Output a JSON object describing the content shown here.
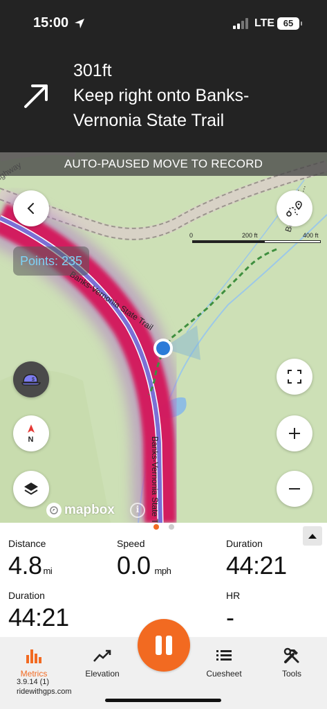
{
  "status_bar": {
    "time": "15:00",
    "network": "LTE",
    "battery": "65",
    "icons": [
      "location-arrow-icon",
      "signal-bars-icon"
    ]
  },
  "navigation": {
    "distance": "301ft",
    "instruction": "Keep right onto Banks-Vernonia State Trail",
    "turn_icon": "arrow-up-right-icon"
  },
  "map": {
    "banner": "AUTO-PAUSED MOVE TO RECORD",
    "points_label": "Points: 235",
    "scale": {
      "labels": [
        "0",
        "200 ft",
        "400 ft"
      ]
    },
    "road_labels": [
      "Banks-Vernonia State Trail",
      "Banks-Vernonia State Trail",
      "ighway",
      "Bo...ooter T..."
    ],
    "attribution": "mapbox",
    "compass_label": "N",
    "colors": {
      "heat_route": "#d4145a",
      "route_line": "#7b6fd6",
      "trail_dashed": "#3f8f3f",
      "user_dot": "#2b7bd8"
    }
  },
  "metrics": {
    "page_dots": 2,
    "active_page": 1,
    "items": [
      {
        "label": "Distance",
        "value": "4.8",
        "unit": "mi"
      },
      {
        "label": "Speed",
        "value": "0.0",
        "unit": "mph"
      },
      {
        "label": "Duration",
        "value": "44:21",
        "unit": ""
      },
      {
        "label": "Duration",
        "value": "44:21",
        "unit": ""
      },
      {
        "label": "HR",
        "value": "-",
        "unit": ""
      }
    ]
  },
  "tabbar": {
    "tabs": [
      {
        "label": "Metrics",
        "icon": "bar-chart-icon",
        "active": true
      },
      {
        "label": "Elevation",
        "icon": "trend-line-icon",
        "active": false
      },
      {
        "label": "Cuesheet",
        "icon": "list-icon",
        "active": false
      },
      {
        "label": "Tools",
        "icon": "tools-icon",
        "active": false
      }
    ],
    "record_button": "pause-icon",
    "version": "3.9.14 (1)",
    "site": "ridewithgps.com",
    "accent": "#f26a21"
  }
}
